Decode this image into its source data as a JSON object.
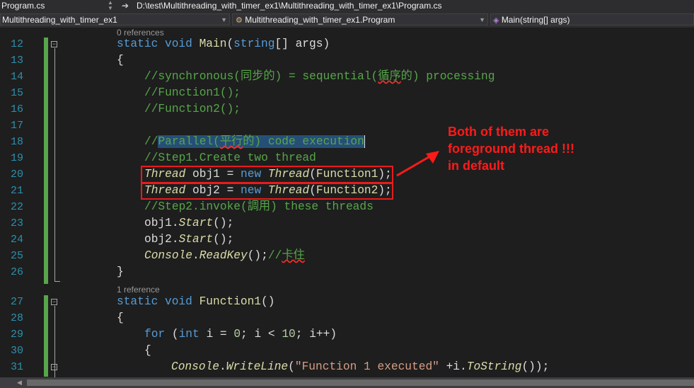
{
  "window": {
    "tab_title": "Program.cs",
    "path": "D:\\test\\Multithreading_with_timer_ex1\\Multithreading_with_timer_ex1\\Program.cs"
  },
  "navbar": {
    "project": "Multithreading_with_timer_ex1",
    "class": "Multithreading_with_timer_ex1.Program",
    "member": "Main(string[] args)"
  },
  "codelens": {
    "main_refs": "0 references",
    "function1_refs": "1 reference"
  },
  "line_numbers": [
    "12",
    "13",
    "14",
    "15",
    "16",
    "17",
    "18",
    "19",
    "20",
    "21",
    "22",
    "23",
    "24",
    "25",
    "26",
    "27",
    "28",
    "29",
    "30",
    "31"
  ],
  "code": {
    "l12": {
      "kw1": "static void ",
      "fn": "Main",
      "p1": "(",
      "kw2": "string",
      "p2": "[] args)"
    },
    "l13": "{",
    "l14": {
      "a": "//synchronous(同步的) = sequential(",
      "b": "循序",
      "c": "的) processing"
    },
    "l15": "//Function1();",
    "l16": "//Function2();",
    "l18": {
      "a": "//",
      "b": "Parallel(",
      "c": "平行",
      "d": "的) code execution"
    },
    "l19": "//Step1.Create two thread",
    "l20": {
      "ty1": "Thread",
      "a": " obj1 = ",
      "kw": "new",
      "sp": " ",
      "ty2": "Thread",
      "b": "(",
      "fn": "Function1",
      "c": ");"
    },
    "l21": {
      "ty1": "Thread",
      "a": " obj2 = ",
      "kw": "new",
      "sp": " ",
      "ty2": "Thread",
      "b": "(",
      "fn": "Function2",
      "c": ");"
    },
    "l22": "//Step2.invoke(調用) these threads",
    "l23": {
      "a": "obj1.",
      "fn": "Start",
      "b": "();"
    },
    "l24": {
      "a": "obj2.",
      "fn": "Start",
      "b": "();"
    },
    "l25": {
      "ty": "Console",
      "a": ".",
      "fn": "ReadKey",
      "b": "();",
      "cm1": "//",
      "cm2": "卡住"
    },
    "l26": "}",
    "l27": {
      "kw1": "static void ",
      "fn": "Function1",
      "p": "()"
    },
    "l28": "{",
    "l29": {
      "kw1": "for",
      "a": " (",
      "kw2": "int",
      "b": " i = ",
      "n1": "0",
      "c": "; i < ",
      "n2": "10",
      "d": "; i++)"
    },
    "l30": "{",
    "l31": {
      "ty": "Console",
      "a": ".",
      "fn": "WriteLine",
      "b": "(",
      "str": "\"Function 1 executed\"",
      "c": " +i.",
      "fn2": "ToString",
      "d": "());"
    }
  },
  "annotation": {
    "line1": "Both of them are",
    "line2": "foreground thread !!!",
    "line3": "in default",
    "color": "#ff1a1a"
  }
}
